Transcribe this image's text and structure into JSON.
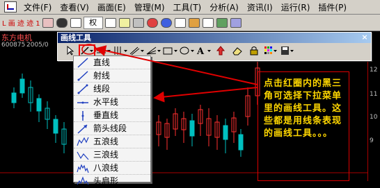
{
  "menubar": {
    "items": [
      "文件(F)",
      "查看(V)",
      "画面(E)",
      "管理(M)",
      "工具(T)",
      "分析(A)",
      "资讯(I)",
      "运行(R)",
      "插件(P)"
    ]
  },
  "toolbar": {
    "left_label": "L 画 迹 迹 1",
    "combo_label": "权",
    "icons": [
      "back-icon",
      "binoculars-icon",
      "grid-icon",
      "page-icon",
      "report-icon",
      "settings-icon",
      "alarm-icon",
      "help-icon",
      "arrow-icon",
      "pin-icon",
      "edit-icon",
      "chart-icon",
      "data-icon"
    ]
  },
  "stock": {
    "name": "东方电机",
    "code": "600875",
    "date": "2005/0"
  },
  "yaxis": [
    "12",
    "11",
    "10",
    "9"
  ],
  "drawing_window": {
    "title": "画线工具",
    "close": "×"
  },
  "line_menu": {
    "items": [
      "直线",
      "射线",
      "线段",
      "水平线",
      "垂直线",
      "箭头线段",
      "五浪线",
      "三浪线",
      "八浪线",
      "头肩形"
    ]
  },
  "annotation": {
    "text": "点击红圈内的黑三角可选择下拉菜单里的画线工具。这些都是用线条表现的画线工具。。。"
  },
  "colors": {
    "accent_red": "#e00000",
    "annotation_yellow": "#ffd700",
    "up_candle": "#ff3030",
    "down_candle": "#00c0c0"
  }
}
